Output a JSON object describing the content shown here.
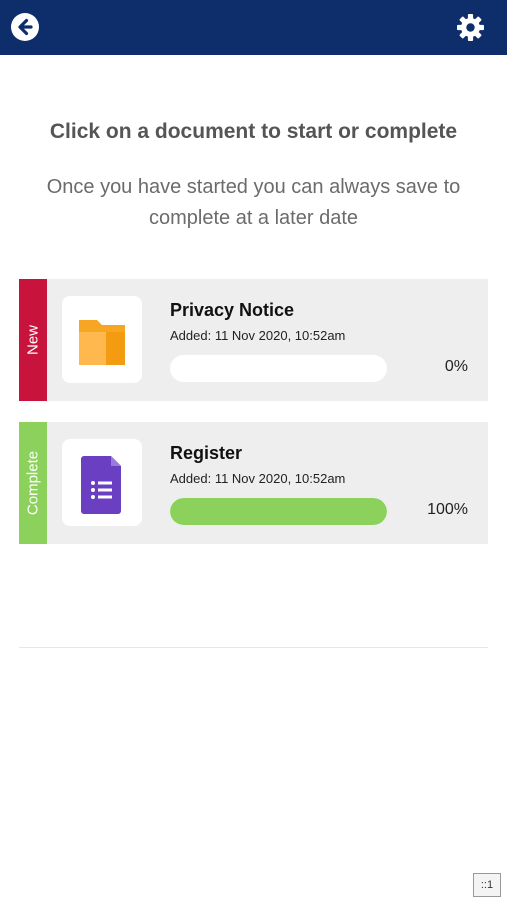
{
  "header": {
    "back_icon": "arrow-left-circle-icon",
    "settings_icon": "gear-icon",
    "background": "#0d2e6b"
  },
  "intro": {
    "heading": "Click on a document to start or complete",
    "subheading": "Once you have started you can always save to complete at a later date"
  },
  "documents": [
    {
      "status": "New",
      "status_color": "#c8143c",
      "icon": "folder-icon",
      "title": "Privacy Notice",
      "added": "Added: 11 Nov 2020, 10:52am",
      "progress": 0,
      "progress_label": "0%"
    },
    {
      "status": "Complete",
      "status_color": "#8bd15c",
      "icon": "form-document-icon",
      "title": "Register",
      "added": "Added: 11 Nov 2020, 10:52am",
      "progress": 100,
      "progress_label": "100%"
    }
  ],
  "footer": {
    "page_indicator": "::1"
  }
}
